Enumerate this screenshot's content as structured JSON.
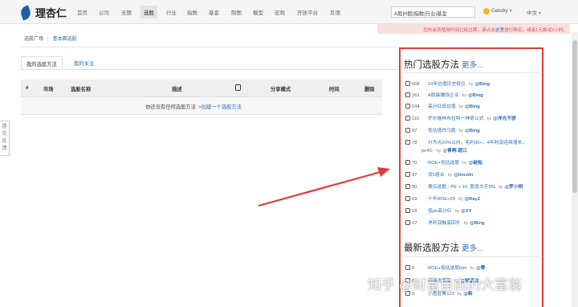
{
  "app": {
    "logo_text": "理杏仁",
    "logo_icon": "leaf-logo-icon"
  },
  "nav": {
    "items": [
      "首页",
      "公司",
      "无题",
      "选股",
      "行业",
      "指数",
      "基金",
      "制图",
      "模型",
      "宏观",
      "开放平台",
      "反馈"
    ],
    "active": "选股"
  },
  "search": {
    "value": "A股|H股|指数|行业|基金"
  },
  "user": {
    "name": "Gatsby",
    "icon": "user-avatar-icon"
  },
  "language": {
    "label": "中文"
  },
  "notice": {
    "text_before": "您的会员使用时间已经过期，请点击",
    "link": "这里",
    "text_after": "进行购买，或者1元尝试2小时。"
  },
  "breadcrumb": {
    "items": [
      "选股广场",
      "基本面选股"
    ]
  },
  "tabs": {
    "my_methods": "我的选股方法",
    "following": "我的关注"
  },
  "table": {
    "headers": [
      "#",
      "市场",
      "选股名称",
      "描述",
      "分享模式",
      "时间",
      "删除"
    ],
    "like_icon": "thumbs-up-icon",
    "empty_text": "你还没有任何选股方法",
    "empty_link": ">创建一个选股方法"
  },
  "feedback": {
    "label": "提交反馈"
  },
  "hot": {
    "title": "热门选股方法",
    "more": "更多...",
    "items": [
      {
        "count": "608",
        "name": "10年估值历史低位",
        "by": "by",
        "author": "@Bing"
      },
      {
        "count": "161",
        "name": "A股最赚钱企业",
        "by": "by",
        "author": "@Bing"
      },
      {
        "count": "144",
        "name": "高分红低估值",
        "by": "by",
        "author": "@Bing"
      },
      {
        "count": "115",
        "name": "乔尔格林布拉特一神奇公式",
        "by": "by",
        "author": "@洋光不骄"
      },
      {
        "count": "97",
        "name": "低估值白马股",
        "by": "by",
        "author": "@Bing"
      },
      {
        "count": "78",
        "name": "分为点20%以内，毛利30+，4年利润连续增长，",
        "name2": "pe40-",
        "by": "by",
        "author": "@青啊-超江"
      },
      {
        "count": "70",
        "name": "ROE+低估选股",
        "by": "by",
        "author": "@破船"
      },
      {
        "count": "37",
        "name": "双5组合",
        "by": "by",
        "author": "@lincoln"
      },
      {
        "count": "30",
        "name": "傻瓜选股 - PE < 10, 股息大于5%",
        "by": "by",
        "author": "@罗小明"
      },
      {
        "count": "19",
        "name": "十年ROE>20",
        "by": "by",
        "author": "@RayZ"
      },
      {
        "count": "18",
        "name": "低pe高分红",
        "by": "by",
        "author": "@XY"
      },
      {
        "count": "17",
        "name": "净利润触底回升",
        "by": "by",
        "author": "@Bing"
      }
    ]
  },
  "latest": {
    "title": "最新选股方法",
    "more": "更多...",
    "items": [
      {
        "count": "0",
        "name": "ROE+低估选股bjm",
        "by": "by",
        "author": "@零"
      },
      {
        "count": "0",
        "name": "行情优质股",
        "by": "by",
        "author": "@财富自"
      },
      {
        "count": "0",
        "name": "小盘蓝筹123",
        "by": "by",
        "author": "@新"
      }
    ]
  },
  "watermark": {
    "text": "知乎 @财富自由的大富翁"
  },
  "colors": {
    "accent": "#2a6fb8",
    "highlight_box": "#e23a3a",
    "notice_bg": "#fbe0e0"
  }
}
